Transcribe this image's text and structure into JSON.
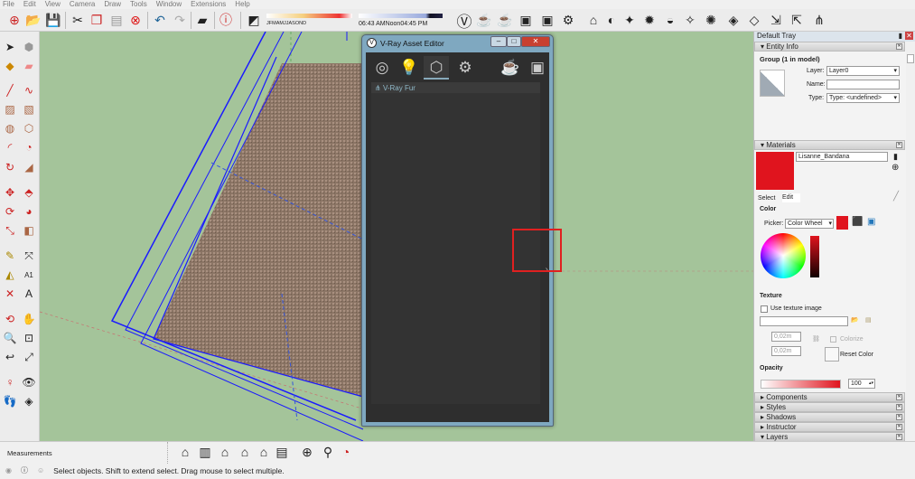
{
  "menu": [
    "File",
    "Edit",
    "View",
    "Camera",
    "Draw",
    "Tools",
    "Window",
    "Extensions",
    "Help"
  ],
  "shadow": {
    "months": [
      "J",
      "F",
      "M",
      "A",
      "M",
      "J",
      "J",
      "A",
      "S",
      "O",
      "N",
      "D"
    ],
    "time_start": "06:43 AM",
    "time_mid": "Noon",
    "time_end": "04:45 PM"
  },
  "vray": {
    "title": "V-Ray Asset Editor",
    "tabs": [
      "materials",
      "lights",
      "geometry",
      "settings"
    ],
    "active_tab": "geometry",
    "items": [
      "V-Ray Fur"
    ],
    "expand_glyph": "›"
  },
  "tray": {
    "title": "Default Tray",
    "entity_info": {
      "header": "Entity Info",
      "heading": "Group (1 in model)",
      "layer_label": "Layer:",
      "layer_value": "Layer0",
      "name_label": "Name:",
      "name_value": "",
      "type_label": "Type:",
      "type_value": "Type: <undefined>"
    },
    "materials": {
      "header": "Materials",
      "name": "Lisanne_Bandana",
      "swatch_color": "#e0141e",
      "tabs": [
        "Select",
        "Edit"
      ],
      "color_heading": "Color",
      "picker_label": "Picker:",
      "picker_value": "Color Wheel",
      "texture_heading": "Texture",
      "use_texture_label": "Use texture image",
      "width": "0,02m",
      "height": "0,02m",
      "colorize_label": "Colorize",
      "reset_label": "Reset Color",
      "opacity_heading": "Opacity",
      "opacity_value": "100"
    },
    "panels": [
      "Components",
      "Styles",
      "Shadows",
      "Instructor",
      "Layers"
    ]
  },
  "measurements_label": "Measurements",
  "status_text": "Select objects. Shift to extend select. Drag mouse to select multiple."
}
